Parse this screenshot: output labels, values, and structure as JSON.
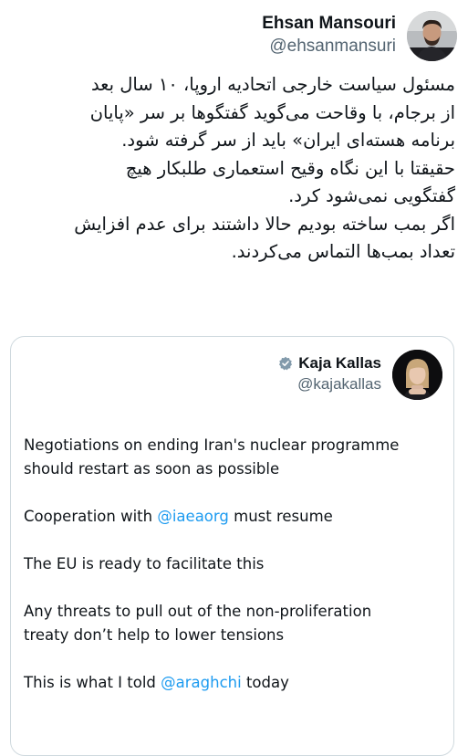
{
  "tweet": {
    "author": {
      "name": "Ehsan Mansouri",
      "handle": "@ehsanmansuri"
    },
    "body_lines": [
      "مسئول سیاست خارجی اتحادیه اروپا، ۱۰ سال بعد",
      "از برجام، با وقاحت می‌گوید گفتگوها بر سر «پایان",
      "برنامه هسته‌ای ایران» باید از سر گرفته شود.",
      "حقیقتا با این نگاه وقیح استعماری طلبکار هیچ",
      "گفتگویی نمی‌شود کرد.",
      "اگر بمب ساخته بودیم حالا داشتند برای عدم افزایش",
      "تعداد بمب‌ها التماس می‌کردند."
    ]
  },
  "quote": {
    "author": {
      "name": "Kaja Kallas",
      "handle": "@kajakallas",
      "verified": true
    },
    "para1_line1": "Negotiations on ending Iran's nuclear programme",
    "para1_line2": "should restart as soon as possible",
    "para2_before": "Cooperation with ",
    "para2_mention": "@iaeaorg",
    "para2_after": " must resume",
    "para3": "The EU is ready to facilitate this",
    "para4_line1": "Any threats to pull out of the non-proliferation",
    "para4_line2": "treaty don’t help to lower tensions",
    "para5_before": "This is what I told ",
    "para5_mention": "@araghchi",
    "para5_after": " today"
  },
  "colors": {
    "text": "#0f1419",
    "secondary": "#536471",
    "link": "#1d9bf0",
    "border": "#cfd9de",
    "verified_badge": "#829aab"
  },
  "icons": {
    "verified": "verified-badge-icon"
  }
}
